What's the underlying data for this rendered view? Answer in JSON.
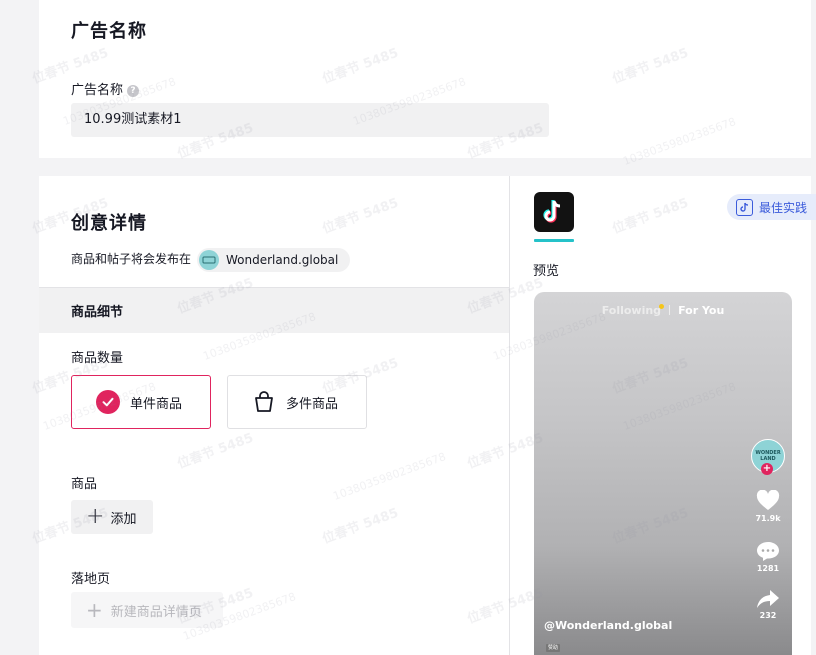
{
  "ad_name_section": {
    "title": "广告名称",
    "field_label": "广告名称",
    "help_icon": "?",
    "value": "10.99测试素材1"
  },
  "creative_section": {
    "title": "创意详情",
    "publish_text": "商品和帖子将会发布在",
    "account_name": "Wonderland.global",
    "product_details_header": "商品细节",
    "product_quantity_label": "商品数量",
    "options": [
      {
        "label": "单件商品",
        "selected": true
      },
      {
        "label": "多件商品",
        "selected": false
      }
    ],
    "product_label": "商品",
    "add_button": "添加",
    "landing_page_label": "落地页",
    "new_detail_page_button": "新建商品详情页"
  },
  "preview_panel": {
    "best_practice_label": "最佳实践",
    "preview_label": "预览",
    "feed_tabs": {
      "following": "Following",
      "for_you": "For You"
    },
    "likes": "71.9k",
    "comments": "1281",
    "shares": "232",
    "handle": "@Wonderland.global",
    "sponsored_tag": "赞助",
    "avatar_text": "WONDER LAND"
  },
  "watermark": {
    "name": "位春节 5485",
    "code": "10380359802385678"
  },
  "colors": {
    "accent": "#e0245e",
    "tiktok_cyan": "#25c2c9",
    "best_practice_blue": "#3b5bdb"
  }
}
